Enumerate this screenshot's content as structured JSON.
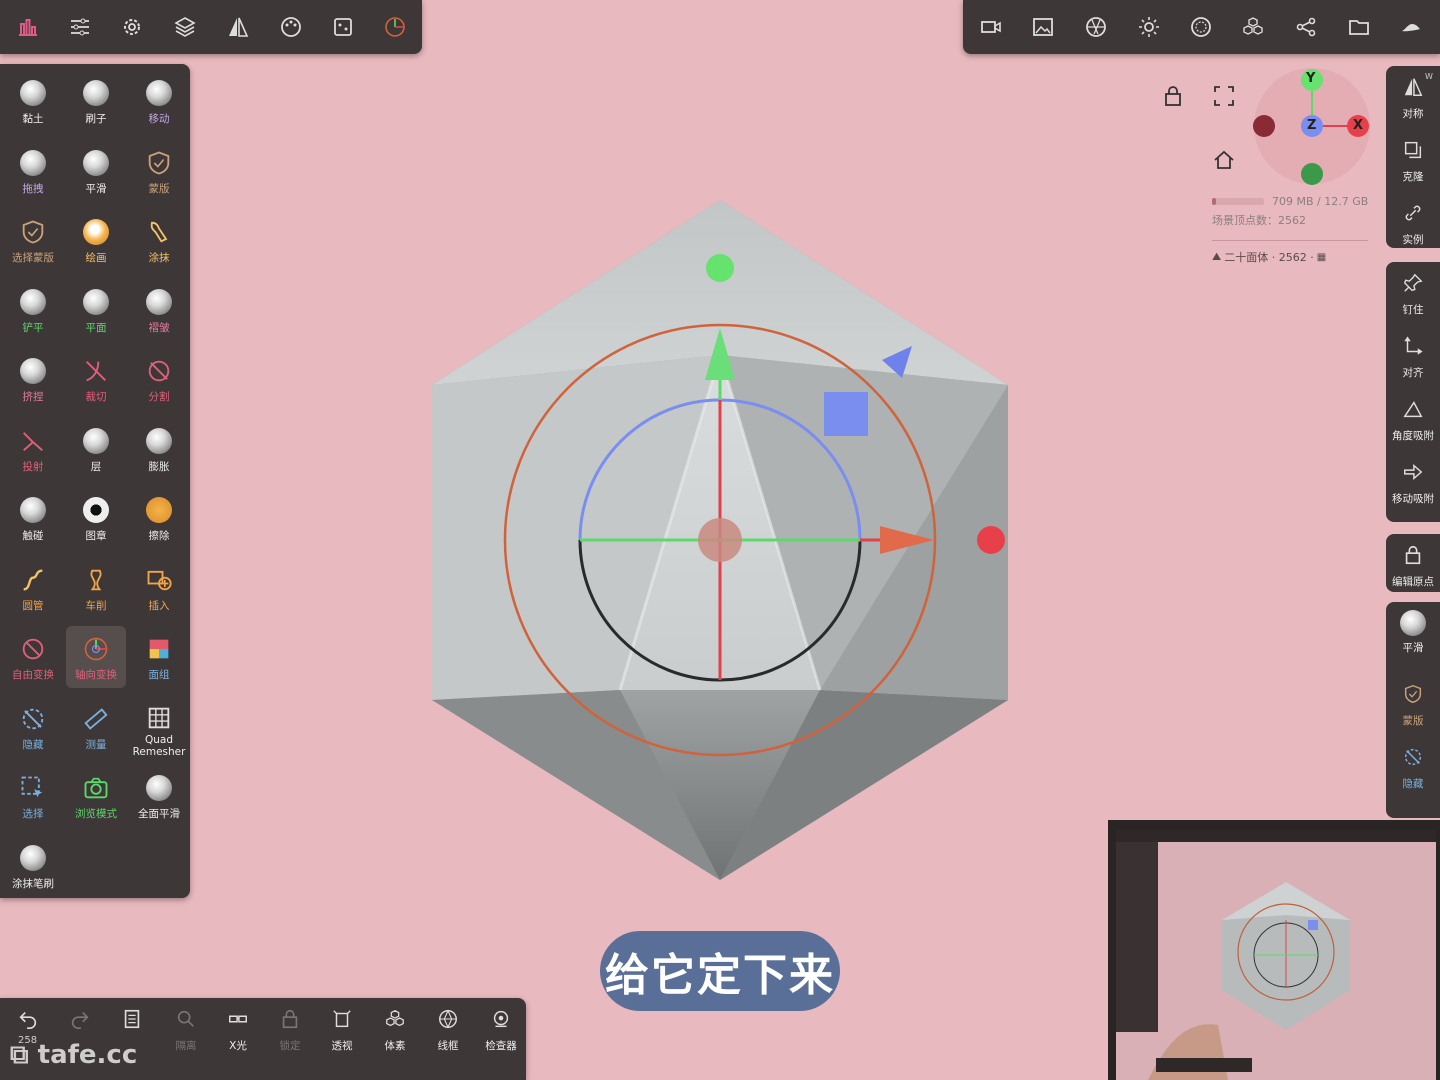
{
  "top_left_toolbar": {
    "icons": [
      "tools-icon",
      "sliders-icon",
      "gear-icon",
      "layers-icon",
      "symmetry-icon",
      "palette-icon",
      "scene-icon",
      "gizmo-icon"
    ]
  },
  "top_right_toolbar": {
    "icons": [
      "camera-icon",
      "image-icon",
      "aperture-icon",
      "sun-icon",
      "matcap-icon",
      "voxel-icon",
      "share-icon",
      "folder-icon",
      "brush-stroke-icon"
    ]
  },
  "tools": [
    {
      "label": "黏土",
      "icon": "sphere"
    },
    {
      "label": "刷子",
      "icon": "sphere"
    },
    {
      "label": "移动",
      "icon": "sphere",
      "dim": true
    },
    {
      "label": "拖拽",
      "icon": "sphere",
      "dim": true
    },
    {
      "label": "平滑",
      "icon": "sphere"
    },
    {
      "label": "蒙版",
      "icon": "shield",
      "dim": true
    },
    {
      "label": "选择蒙版",
      "icon": "shield",
      "dim": true
    },
    {
      "label": "绘画",
      "icon": "sphere-orange"
    },
    {
      "label": "涂抹",
      "icon": "smudge"
    },
    {
      "label": "铲平",
      "icon": "sphere"
    },
    {
      "label": "平面",
      "icon": "sphere"
    },
    {
      "label": "褶皱",
      "icon": "sphere"
    },
    {
      "label": "挤捏",
      "icon": "sphere"
    },
    {
      "label": "裁切",
      "icon": "cut",
      "dim": true
    },
    {
      "label": "分割",
      "icon": "split",
      "dim": true
    },
    {
      "label": "投射",
      "icon": "project",
      "dim": true
    },
    {
      "label": "层",
      "icon": "sphere"
    },
    {
      "label": "膨胀",
      "icon": "sphere"
    },
    {
      "label": "触碰",
      "icon": "sphere"
    },
    {
      "label": "图章",
      "icon": "stamp"
    },
    {
      "label": "擦除",
      "icon": "erase"
    },
    {
      "label": "圆管",
      "icon": "tube",
      "dim": true
    },
    {
      "label": "车削",
      "icon": "lathe",
      "dim": true
    },
    {
      "label": "插入",
      "icon": "insert",
      "dim": true
    },
    {
      "label": "自由变换",
      "icon": "freeform",
      "dim": true
    },
    {
      "label": "轴向变换",
      "icon": "axis",
      "dim": true,
      "active": true
    },
    {
      "label": "面组",
      "icon": "facegroup"
    },
    {
      "label": "隐藏",
      "icon": "hide",
      "dim": true
    },
    {
      "label": "测量",
      "icon": "ruler",
      "dim": true
    },
    {
      "label": "Quad Remesher",
      "icon": "grid"
    },
    {
      "label": "选择",
      "icon": "select",
      "dim": true
    },
    {
      "label": "浏览模式",
      "icon": "camera",
      "dim": true
    },
    {
      "label": "全面平滑",
      "icon": "sphere"
    },
    {
      "label": "涂抹笔刷",
      "icon": "sphere"
    }
  ],
  "right_column": {
    "group1": [
      {
        "label": "对称",
        "icon": "symmetry-icon"
      },
      {
        "label": "克隆",
        "icon": "clone-icon"
      },
      {
        "label": "实例",
        "icon": "link-icon"
      }
    ],
    "group2": [
      {
        "label": "钉住",
        "icon": "pin-icon"
      },
      {
        "label": "对齐",
        "icon": "align-icon"
      },
      {
        "label": "角度吸附",
        "icon": "angle-icon"
      },
      {
        "label": "移动吸附",
        "icon": "arrow-icon"
      }
    ],
    "group3": [
      {
        "label": "编辑原点",
        "icon": "lock-icon"
      }
    ],
    "group4": [
      {
        "label": "平滑",
        "icon": "sphere"
      },
      {
        "label": "蒙版",
        "icon": "shield"
      },
      {
        "label": "隐藏",
        "icon": "hide"
      }
    ],
    "w_label": "W"
  },
  "orientation": {
    "y": "Y",
    "x": "X",
    "z": "Z"
  },
  "info": {
    "memory": "709 MB / 12.7 GB",
    "vertices": "场景顶点数：2562",
    "object": "二十面体 · 2562 · "
  },
  "bottom_bar": {
    "undo_count": "258",
    "items": [
      {
        "label": "",
        "icon": "undo-icon"
      },
      {
        "label": "",
        "icon": "redo-icon",
        "dim": true
      },
      {
        "label": "",
        "icon": "doc-icon"
      },
      {
        "label": "隔离",
        "icon": "search-icon",
        "dim": true
      },
      {
        "label": "X光",
        "icon": "xray-icon"
      },
      {
        "label": "锁定",
        "icon": "lock-icon",
        "dim": true
      },
      {
        "label": "透视",
        "icon": "perspective-icon"
      },
      {
        "label": "体素",
        "icon": "voxel-icon"
      },
      {
        "label": "线框",
        "icon": "wireframe-icon"
      },
      {
        "label": "检查器",
        "icon": "inspector-icon"
      }
    ]
  },
  "subtitle": "给它定下来",
  "watermark": "tafe.cc",
  "colors": {
    "background": "#e8b9be",
    "panel": "#3d3737",
    "axis_x": "#e0414a",
    "axis_y": "#5cd96a",
    "axis_z": "#7a8ef0",
    "accent": "#e05a8a"
  }
}
